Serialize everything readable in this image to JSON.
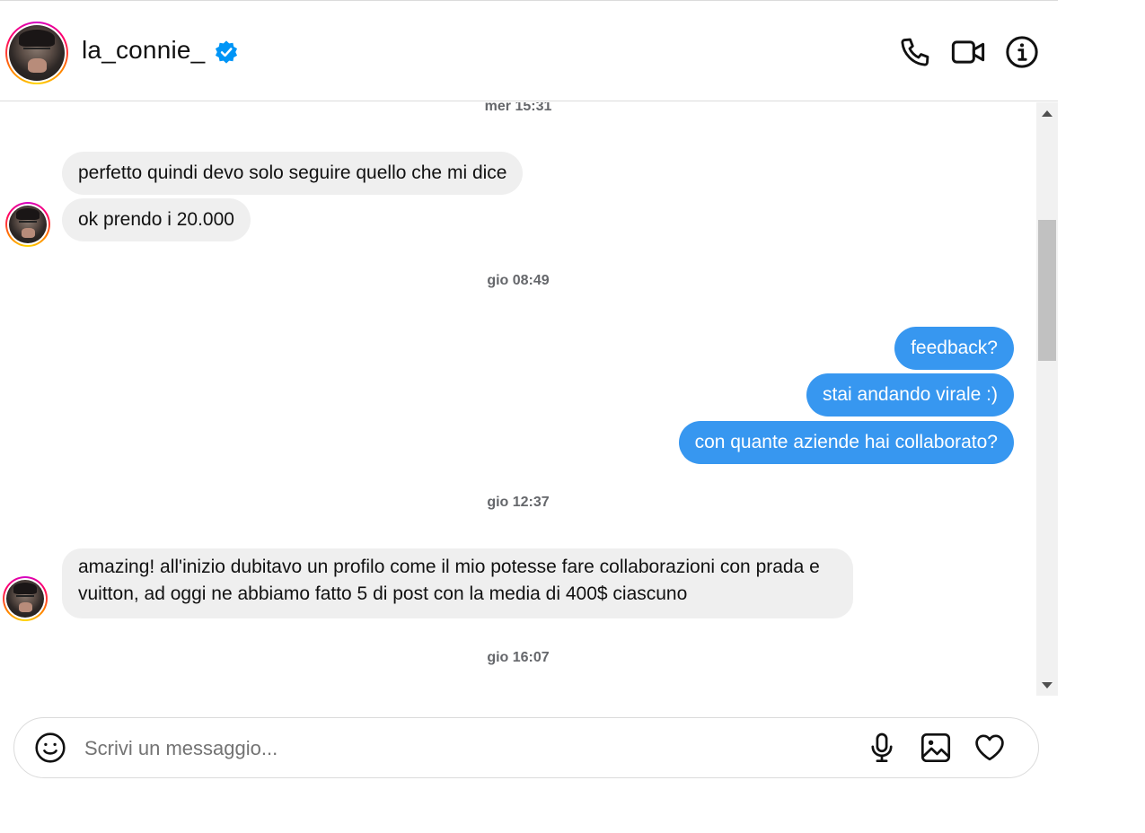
{
  "header": {
    "username": "la_connie_",
    "verified": true,
    "icons": [
      "phone-icon",
      "video-camera-icon",
      "info-icon"
    ]
  },
  "conversation": {
    "timestamps": [
      "mer 15:31",
      "gio 08:49",
      "gio 12:37",
      "gio 16:07"
    ],
    "messages": [
      {
        "sender": "them",
        "text": "perfetto quindi devo solo seguire quello che mi dice"
      },
      {
        "sender": "them",
        "text": "ok prendo i 20.000"
      },
      {
        "sender": "me",
        "text": "feedback?"
      },
      {
        "sender": "me",
        "text": "stai andando virale :)"
      },
      {
        "sender": "me",
        "text": "con quante aziende hai collaborato?"
      },
      {
        "sender": "them",
        "text": "amazing! all'inizio dubitavo un profilo come il mio potesse fare collaborazioni con prada e vuitton, ad oggi ne abbiamo fatto 5 di post con la media di 400$ ciascuno"
      }
    ]
  },
  "composer": {
    "placeholder": "Scrivi un messaggio...",
    "value": "",
    "icons": [
      "emoji-icon",
      "microphone-icon",
      "image-icon",
      "heart-icon"
    ]
  },
  "colors": {
    "outgoing_bubble": "#3797f0",
    "incoming_bubble": "#efefef",
    "verified_badge": "#0095f6",
    "timestamp": "#65676b"
  }
}
